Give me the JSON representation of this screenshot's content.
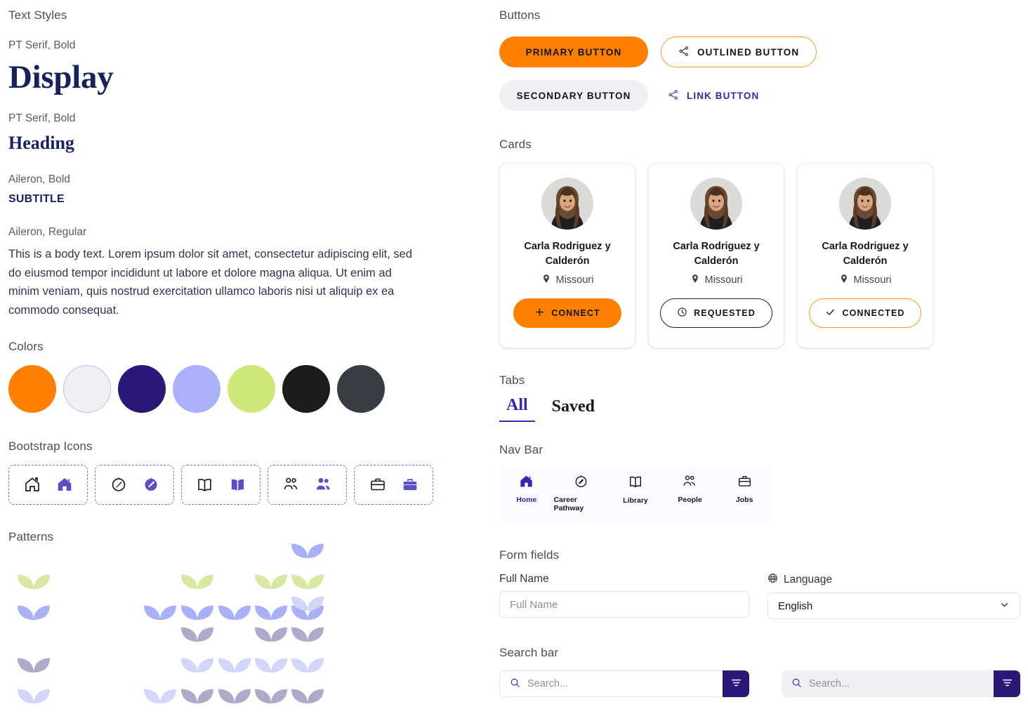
{
  "left": {
    "text_styles": {
      "section": "Text Styles",
      "items": [
        {
          "meta": "PT Serif, Bold",
          "sample": "Display"
        },
        {
          "meta": "PT Serif, Bold",
          "sample": "Heading"
        },
        {
          "meta": "Aileron, Bold",
          "sample": "SUBTITLE"
        },
        {
          "meta": "Aileron, Regular",
          "sample": "This is a body text. Lorem ipsum dolor sit amet, consectetur adipiscing elit, sed do eiusmod tempor incididunt ut labore et dolore magna aliqua. Ut enim ad minim veniam, quis nostrud exercitation ullamco laboris nisi ut aliquip ex ea commodo consequat."
        }
      ]
    },
    "colors": {
      "section": "Colors",
      "swatches": [
        {
          "name": "orange",
          "hex": "#FF8000",
          "ring": false
        },
        {
          "name": "off-white",
          "hex": "#EFF0F4",
          "ring": true
        },
        {
          "name": "indigo",
          "hex": "#2B1778",
          "ring": false
        },
        {
          "name": "periwinkle",
          "hex": "#AAB0FC",
          "ring": false
        },
        {
          "name": "lime",
          "hex": "#CDE878",
          "ring": false
        },
        {
          "name": "near-black",
          "hex": "#1C1C1C",
          "ring": false
        },
        {
          "name": "slate",
          "hex": "#383D45",
          "ring": false
        }
      ]
    },
    "bootstrap_icons": {
      "section": "Bootstrap Icons",
      "groups": [
        {
          "outline": "house-icon",
          "filled": "house-fill-icon"
        },
        {
          "outline": "compass-icon",
          "filled": "compass-fill-icon"
        },
        {
          "outline": "book-icon",
          "filled": "book-fill-icon"
        },
        {
          "outline": "people-icon",
          "filled": "people-fill-icon"
        },
        {
          "outline": "briefcase-icon",
          "filled": "briefcase-fill-icon"
        }
      ]
    },
    "patterns": {
      "section": "Patterns",
      "leaf_colors": {
        "lime": "#D7E9A0",
        "periwinkle": "#A8B1F5",
        "mauve": "#B0AAC8",
        "pale": "#D2D6F8"
      },
      "groups": [
        {
          "name": "primary-pattern",
          "single": [
            "lime",
            "periwinkle"
          ],
          "columns": [
            [
              "periwinkle"
            ],
            [
              "lime",
              "periwinkle"
            ],
            [
              "periwinkle"
            ],
            [
              "lime",
              "periwinkle"
            ],
            [
              "periwinkle",
              "lime",
              "periwinkle"
            ]
          ]
        },
        {
          "name": "muted-pattern",
          "single": [
            "mauve",
            "pale"
          ],
          "columns": [
            [
              "pale"
            ],
            [
              "mauve",
              "pale",
              "mauve"
            ],
            [
              "pale",
              "mauve"
            ],
            [
              "mauve",
              "pale",
              "mauve"
            ],
            [
              "pale",
              "mauve",
              "pale",
              "mauve"
            ]
          ]
        }
      ]
    }
  },
  "right": {
    "buttons": {
      "section": "Buttons",
      "primary": "PRIMARY BUTTON",
      "outlined": "OUTLINED BUTTON",
      "secondary": "SECONDARY BUTTON",
      "link": "LINK BUTTON",
      "share_icon": "share-icon"
    },
    "cards": {
      "section": "Cards",
      "items": [
        {
          "name": "Carla Rodriguez y Calderón",
          "location": "Missouri",
          "action": "CONNECT",
          "state": "connect",
          "icon": "plus-icon"
        },
        {
          "name": "Carla Rodriguez y Calderón",
          "location": "Missouri",
          "action": "REQUESTED",
          "state": "requested",
          "icon": "clock-icon"
        },
        {
          "name": "Carla Rodriguez y Calderón",
          "location": "Missouri",
          "action": "CONNECTED",
          "state": "connected",
          "icon": "check-icon"
        }
      ],
      "pin_icon": "map-pin-icon"
    },
    "tabs": {
      "section": "Tabs",
      "items": [
        {
          "label": "All",
          "active": true
        },
        {
          "label": "Saved",
          "active": false
        }
      ]
    },
    "navbar": {
      "section": "Nav Bar",
      "items": [
        {
          "label": "Home",
          "icon": "house-fill-icon",
          "active": true
        },
        {
          "label": "Career Pathway",
          "icon": "compass-icon",
          "active": false
        },
        {
          "label": "Library",
          "icon": "book-icon",
          "active": false
        },
        {
          "label": "People",
          "icon": "people-icon",
          "active": false
        },
        {
          "label": "Jobs",
          "icon": "briefcase-icon",
          "active": false
        }
      ]
    },
    "form": {
      "section": "Form fields",
      "full_name": {
        "label": "Full Name",
        "placeholder": "Full Name",
        "value": ""
      },
      "language": {
        "label": "Language",
        "icon": "globe-icon",
        "value": "English",
        "chevron": "chevron-down-icon"
      }
    },
    "search": {
      "section": "Search bar",
      "placeholder": "Search...",
      "search_icon": "search-icon",
      "filter_icon": "filter-icon"
    }
  }
}
